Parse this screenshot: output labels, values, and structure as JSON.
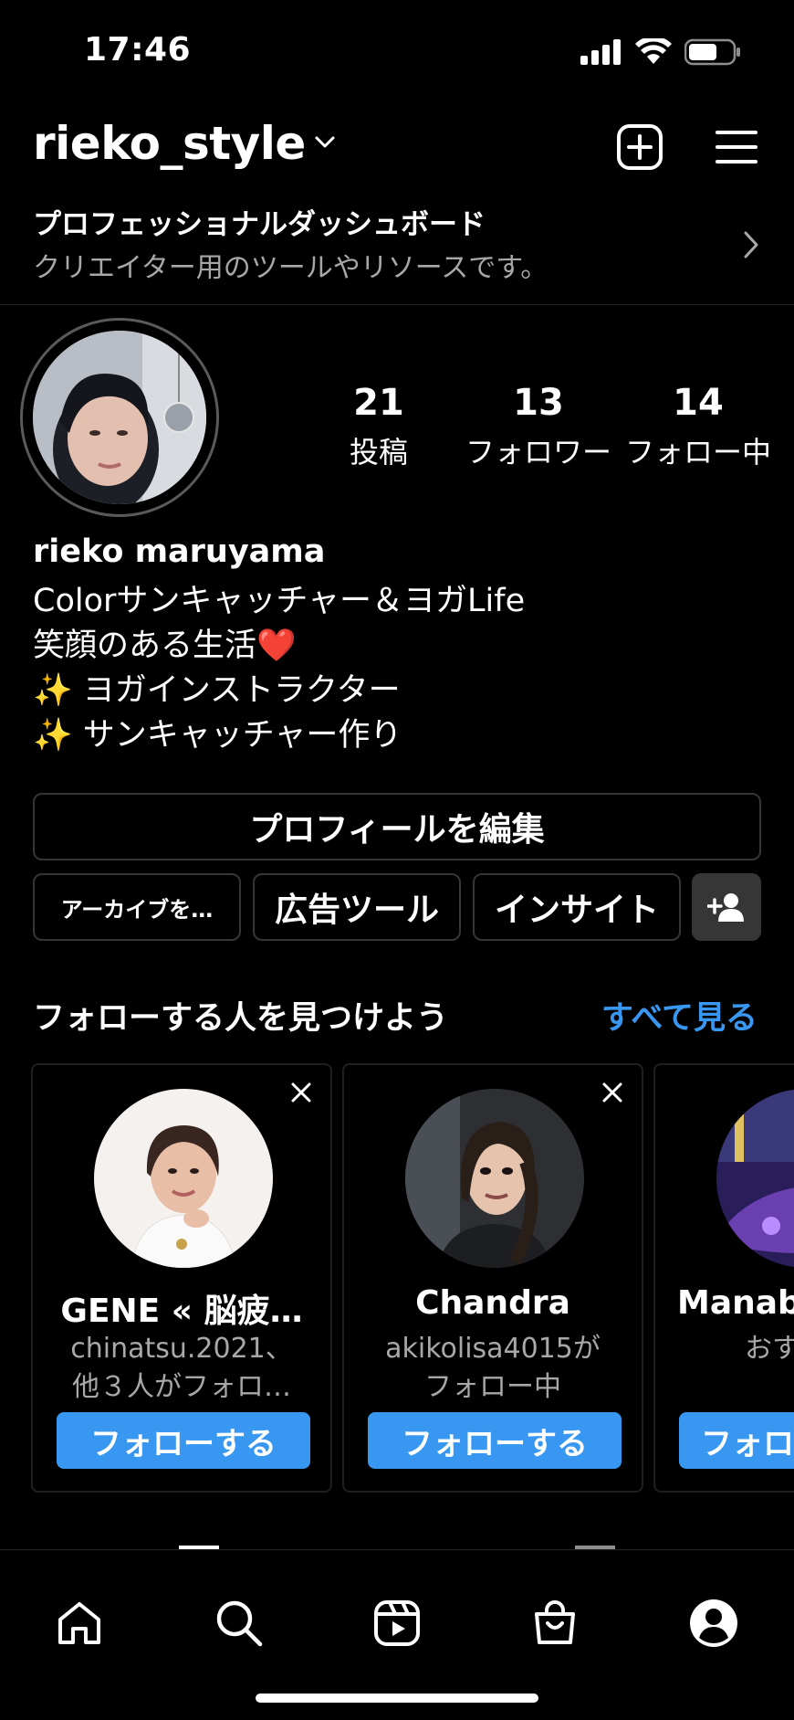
{
  "status_bar": {
    "time": "17:46"
  },
  "header": {
    "username": "rieko_style"
  },
  "dashboard": {
    "title": "プロフェッショナルダッシュボード",
    "subtitle": "クリエイター用のツールやリソースです。"
  },
  "profile": {
    "stats": [
      {
        "value": "21",
        "label": "投稿"
      },
      {
        "value": "13",
        "label": "フォロワー"
      },
      {
        "value": "14",
        "label": "フォロー中"
      }
    ],
    "name": "rieko maruyama",
    "bio_lines": [
      "Colorサンキャッチャー＆ヨガLife",
      "笑顔のある生活❤️",
      "✨ ヨガインストラクター",
      "✨ サンキャッチャー作り"
    ]
  },
  "buttons": {
    "edit_profile": "プロフィールを編集",
    "archive": "アーカイブを…",
    "ad_tools": "広告ツール",
    "insights": "インサイト"
  },
  "suggestions": {
    "title": "フォローする人を見つけよう",
    "see_all": "すべて見る",
    "cards": [
      {
        "name": "GENE « 脳疲…",
        "sub1": "chinatsu.2021、",
        "sub2": "他３人がフォロ…",
        "follow": "フォローする"
      },
      {
        "name": "Chandra",
        "sub1": "akikolisa4015が",
        "sub2": "フォロー中",
        "follow": "フォローする"
      },
      {
        "name": "Manabu",
        "sub1": "おす",
        "sub2": "",
        "follow": "フォロ"
      }
    ]
  },
  "icons": {
    "header": [
      "chevron-down-icon",
      "new-post-icon",
      "menu-icon"
    ],
    "nav": [
      "home-icon",
      "search-icon",
      "reels-icon",
      "shop-icon",
      "profile-icon"
    ]
  },
  "colors": {
    "accent": "#3897f0",
    "background": "#000000",
    "secondary_text": "#a8a8a8",
    "border": "#363636"
  }
}
